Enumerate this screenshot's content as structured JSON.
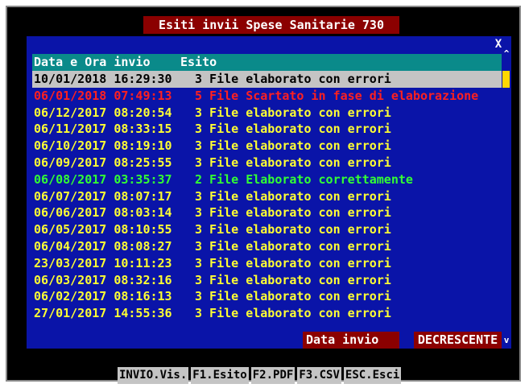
{
  "window": {
    "title": "Esiti invii Spese Sanitarie 730",
    "close_glyph": "X"
  },
  "colors": {
    "error": "#ffff33",
    "rejected": "#ff2020",
    "success": "#33ff33",
    "selected_text": "#000000"
  },
  "table": {
    "columns": [
      "Data e Ora invio",
      "Esito"
    ],
    "rows": [
      {
        "date": "10/01/2018 16:29:30",
        "esito": "3 File elaborato con errori",
        "status": "selected"
      },
      {
        "date": "06/01/2018 07:49:13",
        "esito": "5 File Scartato in fase di elaborazione",
        "status": "rejected"
      },
      {
        "date": "06/12/2017 08:20:54",
        "esito": "3 File elaborato con errori",
        "status": "error"
      },
      {
        "date": "06/11/2017 08:33:15",
        "esito": "3 File elaborato con errori",
        "status": "error"
      },
      {
        "date": "06/10/2017 08:19:10",
        "esito": "3 File elaborato con errori",
        "status": "error"
      },
      {
        "date": "06/09/2017 08:25:55",
        "esito": "3 File elaborato con errori",
        "status": "error"
      },
      {
        "date": "06/08/2017 03:35:37",
        "esito": "2 File Elaborato correttamente",
        "status": "success"
      },
      {
        "date": "06/07/2017 08:07:17",
        "esito": "3 File elaborato con errori",
        "status": "error"
      },
      {
        "date": "06/06/2017 08:03:14",
        "esito": "3 File elaborato con errori",
        "status": "error"
      },
      {
        "date": "06/05/2017 08:10:55",
        "esito": "3 File elaborato con errori",
        "status": "error"
      },
      {
        "date": "06/04/2017 08:08:27",
        "esito": "3 File elaborato con errori",
        "status": "error"
      },
      {
        "date": "23/03/2017 10:11:23",
        "esito": "3 File elaborato con errori",
        "status": "error"
      },
      {
        "date": "06/03/2017 08:32:16",
        "esito": "3 File elaborato con errori",
        "status": "error"
      },
      {
        "date": "06/02/2017 08:16:13",
        "esito": "3 File elaborato con errori",
        "status": "error"
      },
      {
        "date": "27/01/2017 14:55:36",
        "esito": "3 File elaborato con errori",
        "status": "error"
      }
    ]
  },
  "sort": {
    "field": "Data invio",
    "direction": "DECRESCENTE"
  },
  "scrollbar": {
    "up_glyph": "^",
    "down_glyph": "v"
  },
  "footer": {
    "keys": [
      "INVIO.Vis.",
      "F1.Esito",
      "F2.PDF",
      "F3.CSV",
      "ESC.Esci"
    ]
  }
}
